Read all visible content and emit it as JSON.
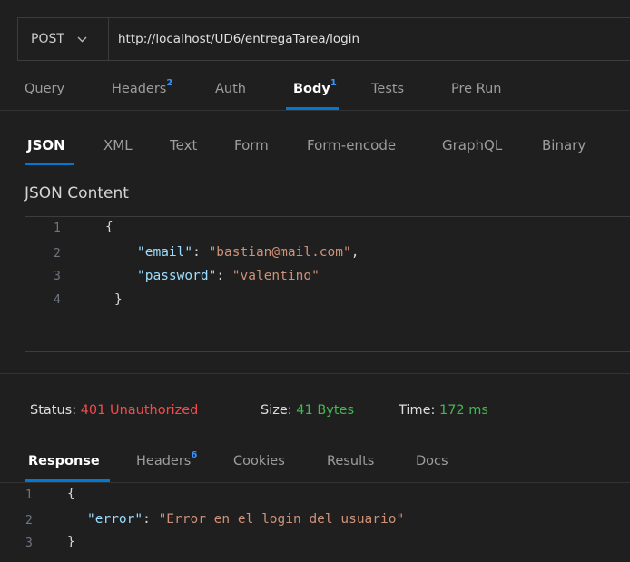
{
  "request": {
    "method": "POST",
    "url": "http://localhost/UD6/entregaTarea/login"
  },
  "request_tabs": [
    {
      "label": "Query",
      "badge": ""
    },
    {
      "label": "Headers",
      "badge": "2"
    },
    {
      "label": "Auth",
      "badge": ""
    },
    {
      "label": "Body",
      "badge": "1"
    },
    {
      "label": "Tests",
      "badge": ""
    },
    {
      "label": "Pre Run",
      "badge": ""
    }
  ],
  "body_tabs": [
    "JSON",
    "XML",
    "Text",
    "Form",
    "Form-encode",
    "GraphQL",
    "Binary"
  ],
  "json_content_title": "JSON Content",
  "request_body": {
    "line_numbers": [
      "1",
      "2",
      "3",
      "4"
    ],
    "open_brace": "{",
    "email_key": "\"email\"",
    "email_value": "\"bastian@mail.com\"",
    "password_key": "\"password\"",
    "password_value": "\"valentino\"",
    "close_brace": "}"
  },
  "status": {
    "status_label": "Status:",
    "status_value": "401 Unauthorized",
    "size_label": "Size:",
    "size_value": "41 Bytes",
    "time_label": "Time:",
    "time_value": "172 ms",
    "colors": {
      "error": "#f14c4c",
      "ok": "#3fb950"
    }
  },
  "response_tabs": [
    {
      "label": "Response",
      "badge": ""
    },
    {
      "label": "Headers",
      "badge": "6"
    },
    {
      "label": "Cookies",
      "badge": ""
    },
    {
      "label": "Results",
      "badge": ""
    },
    {
      "label": "Docs",
      "badge": ""
    }
  ],
  "response_body": {
    "line_numbers": [
      "1",
      "2",
      "3"
    ],
    "open_brace": "{",
    "error_key": "\"error\"",
    "error_value": "\"Error en el login del usuario\"",
    "close_brace": "}"
  },
  "icons": {
    "method_dropdown": "chevron-down-icon"
  },
  "accent_color": "#0078d4"
}
